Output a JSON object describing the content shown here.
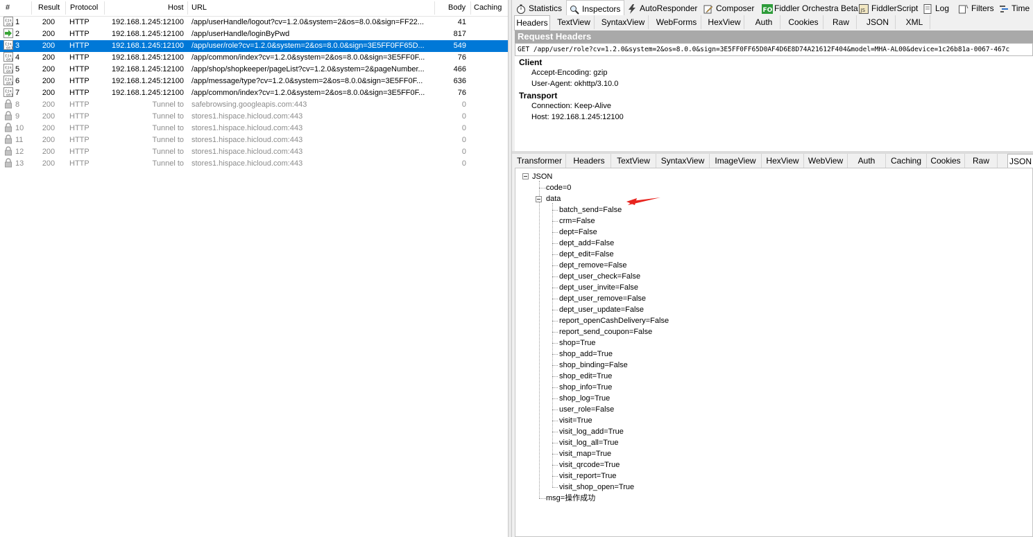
{
  "session_list": {
    "columns": [
      "#",
      "Result",
      "Protocol",
      "Host",
      "URL",
      "Body",
      "Caching"
    ],
    "rows": [
      {
        "num": "1",
        "result": "200",
        "protocol": "HTTP",
        "host": "192.168.1.245:12100",
        "url": "/app/userHandle/logout?cv=1.2.0&system=2&os=8.0.0&sign=FF22...",
        "body": "41",
        "icon": "json-icon",
        "state": "normal"
      },
      {
        "num": "2",
        "result": "200",
        "protocol": "HTTP",
        "host": "192.168.1.245:12100",
        "url": "/app/userHandle/loginByPwd",
        "body": "817",
        "icon": "post-arrow-icon",
        "state": "normal"
      },
      {
        "num": "3",
        "result": "200",
        "protocol": "HTTP",
        "host": "192.168.1.245:12100",
        "url": "/app/user/role?cv=1.2.0&system=2&os=8.0.0&sign=3E5FF0FF65D...",
        "body": "549",
        "icon": "json-icon",
        "state": "selected"
      },
      {
        "num": "4",
        "result": "200",
        "protocol": "HTTP",
        "host": "192.168.1.245:12100",
        "url": "/app/common/index?cv=1.2.0&system=2&os=8.0.0&sign=3E5FF0F...",
        "body": "76",
        "icon": "json-icon",
        "state": "normal"
      },
      {
        "num": "5",
        "result": "200",
        "protocol": "HTTP",
        "host": "192.168.1.245:12100",
        "url": "/app/shop/shopkeeper/pageList?cv=1.2.0&system=2&pageNumber...",
        "body": "466",
        "icon": "json-icon",
        "state": "normal"
      },
      {
        "num": "6",
        "result": "200",
        "protocol": "HTTP",
        "host": "192.168.1.245:12100",
        "url": "/app/message/type?cv=1.2.0&system=2&os=8.0.0&sign=3E5FF0F...",
        "body": "636",
        "icon": "json-icon",
        "state": "normal"
      },
      {
        "num": "7",
        "result": "200",
        "protocol": "HTTP",
        "host": "192.168.1.245:12100",
        "url": "/app/common/index?cv=1.2.0&system=2&os=8.0.0&sign=3E5FF0F...",
        "body": "76",
        "icon": "json-icon",
        "state": "normal"
      },
      {
        "num": "8",
        "result": "200",
        "protocol": "HTTP",
        "host": "Tunnel to",
        "url": "safebrowsing.googleapis.com:443",
        "body": "0",
        "icon": "lock-icon",
        "state": "grey"
      },
      {
        "num": "9",
        "result": "200",
        "protocol": "HTTP",
        "host": "Tunnel to",
        "url": "stores1.hispace.hicloud.com:443",
        "body": "0",
        "icon": "lock-icon",
        "state": "grey"
      },
      {
        "num": "10",
        "result": "200",
        "protocol": "HTTP",
        "host": "Tunnel to",
        "url": "stores1.hispace.hicloud.com:443",
        "body": "0",
        "icon": "lock-icon",
        "state": "grey"
      },
      {
        "num": "11",
        "result": "200",
        "protocol": "HTTP",
        "host": "Tunnel to",
        "url": "stores1.hispace.hicloud.com:443",
        "body": "0",
        "icon": "lock-icon",
        "state": "grey"
      },
      {
        "num": "12",
        "result": "200",
        "protocol": "HTTP",
        "host": "Tunnel to",
        "url": "stores1.hispace.hicloud.com:443",
        "body": "0",
        "icon": "lock-icon",
        "state": "grey"
      },
      {
        "num": "13",
        "result": "200",
        "protocol": "HTTP",
        "host": "Tunnel to",
        "url": "stores1.hispace.hicloud.com:443",
        "body": "0",
        "icon": "lock-icon",
        "state": "grey"
      }
    ]
  },
  "top_tabs": [
    {
      "label": "Statistics",
      "icon": "stopwatch-icon"
    },
    {
      "label": "Inspectors",
      "icon": "magnifier-icon",
      "active": true
    },
    {
      "label": "AutoResponder",
      "icon": "lightning-icon"
    },
    {
      "label": "Composer",
      "icon": "pencil-icon"
    },
    {
      "label": "Fiddler Orchestra Beta",
      "icon": "fo-icon"
    },
    {
      "label": "FiddlerScript",
      "icon": "js-icon"
    },
    {
      "label": "Log",
      "icon": "log-icon"
    },
    {
      "label": "Filters",
      "icon": "filter-icon"
    },
    {
      "label": "Time",
      "icon": "timeline-icon"
    }
  ],
  "request_tabs": [
    "Headers",
    "TextView",
    "SyntaxView",
    "WebForms",
    "HexView",
    "Auth",
    "Cookies",
    "Raw",
    "JSON",
    "XML"
  ],
  "request": {
    "section_title": "Request Headers",
    "request_line": "GET /app/user/role?cv=1.2.0&system=2&os=8.0.0&sign=3E5FF0FF65D0AF4D6E8D74A21612F404&model=MHA-AL00&device=1c26b81a-0067-467c",
    "groups": [
      {
        "name": "Client",
        "headers": [
          "Accept-Encoding: gzip",
          "User-Agent: okhttp/3.10.0"
        ]
      },
      {
        "name": "Transport",
        "headers": [
          "Connection: Keep-Alive",
          "Host: 192.168.1.245:12100"
        ]
      }
    ]
  },
  "response_tabs": [
    "Transformer",
    "Headers",
    "TextView",
    "SyntaxView",
    "ImageView",
    "HexView",
    "WebView",
    "Auth",
    "Caching",
    "Cookies",
    "Raw",
    "JSON"
  ],
  "response_active_tab": "JSON",
  "json_tree": {
    "root": "JSON",
    "code": "code=0",
    "data_label": "data",
    "data_items": [
      "batch_send=False",
      "crm=False",
      "dept=False",
      "dept_add=False",
      "dept_edit=False",
      "dept_remove=False",
      "dept_user_check=False",
      "dept_user_invite=False",
      "dept_user_remove=False",
      "dept_user_update=False",
      "report_openCashDelivery=False",
      "report_send_coupon=False",
      "shop=True",
      "shop_add=True",
      "shop_binding=False",
      "shop_edit=True",
      "shop_info=True",
      "shop_log=True",
      "user_role=False",
      "visit=True",
      "visit_log_add=True",
      "visit_log_all=True",
      "visit_map=True",
      "visit_qrcode=True",
      "visit_report=True",
      "visit_shop_open=True"
    ],
    "msg": "msg=操作成功"
  },
  "colors": {
    "selection": "#0078d7",
    "annotation_arrow": "#e8251f"
  }
}
